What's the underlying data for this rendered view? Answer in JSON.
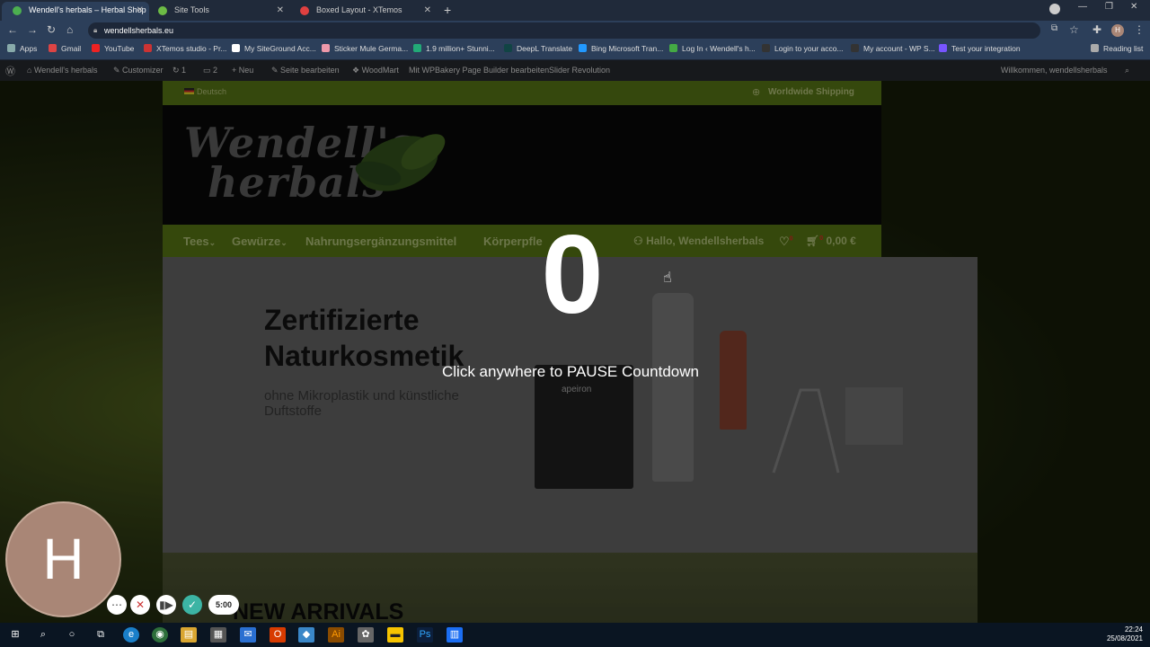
{
  "browser": {
    "tabs": [
      {
        "title": "Wendell's herbals – Herbal Shop",
        "active": true,
        "favicon_color": "#4caf50"
      },
      {
        "title": "Site Tools",
        "active": false,
        "favicon_color": "#6dbb45"
      },
      {
        "title": "Boxed Layout - XTemos",
        "active": false,
        "favicon_color": "#e04040"
      }
    ],
    "new_tab": "+",
    "url": "wendellsherbals.eu",
    "bookmarks": [
      {
        "label": "Apps",
        "color": "#8aa"
      },
      {
        "label": "Gmail",
        "color": "#d44"
      },
      {
        "label": "YouTube",
        "color": "#e22"
      },
      {
        "label": "XTemos studio - Pr...",
        "color": "#c33"
      },
      {
        "label": "My SiteGround Acc...",
        "color": "#fff"
      },
      {
        "label": "Sticker Mule Germa...",
        "color": "#e9a"
      },
      {
        "label": "1.9 million+ Stunni...",
        "color": "#2a7"
      },
      {
        "label": "DeepL Translate",
        "color": "#144"
      },
      {
        "label": "Bing Microsoft Tran...",
        "color": "#29f"
      },
      {
        "label": "Log In ‹ Wendell's h...",
        "color": "#4a4"
      },
      {
        "label": "Login to your acco...",
        "color": "#333"
      },
      {
        "label": "My account - WP S...",
        "color": "#333"
      },
      {
        "label": "Test your integration",
        "color": "#75f"
      }
    ],
    "reading_list": "Reading list",
    "profile_initial": "H"
  },
  "wp_admin": {
    "site_name": "Wendell's herbals",
    "customizer": "Customizer",
    "updates": "1",
    "comments": "2",
    "new": "Neu",
    "edit_page": "Seite bearbeiten",
    "woodmart": "WoodMart",
    "wpbakery": "Mit WPBakery Page Builder bearbeiten",
    "slider": "Slider Revolution",
    "greeting": "Willkommen, wendellsherbals"
  },
  "site": {
    "language": "Deutsch",
    "shipping": "Worldwide Shipping",
    "logo_line1": "Wendell's",
    "logo_line2": "herbals",
    "nav": [
      "Tees",
      "Gewürze",
      "Nahrungsergänzungsmittel",
      "Körperpfle"
    ],
    "account": "Hallo, Wendellsherbals",
    "wishlist_count": "0",
    "cart_count": "0",
    "cart_total": "0,00 €",
    "hero_title_line1": "Zertifizierte",
    "hero_title_line2": "Naturkosmetik",
    "hero_subtitle": "ohne Mikroplastik und künstliche Duftstoffe",
    "product_brand": "apeiron",
    "new_arrivals": "NEW ARRIVALS"
  },
  "overlay": {
    "countdown": "0",
    "message": "Click anywhere to PAUSE Countdown"
  },
  "recorder": {
    "avatar_initial": "H",
    "time": "5:00",
    "accent": "#3cb4a4"
  },
  "taskbar": {
    "time": "22:24",
    "date": "25/08/2021"
  }
}
